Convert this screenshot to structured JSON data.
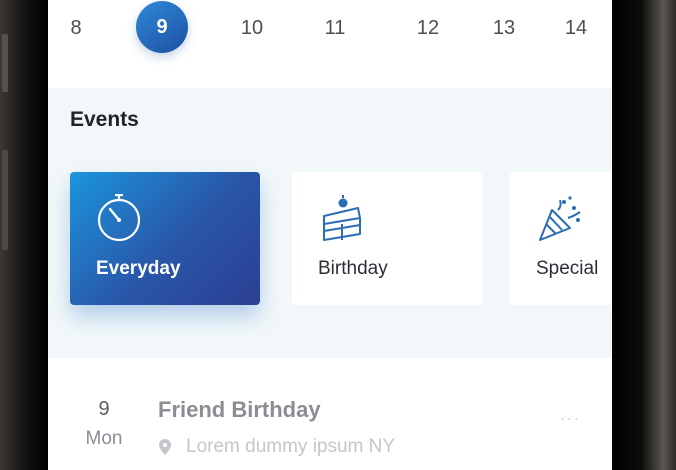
{
  "dates": {
    "items": [
      "8",
      "10",
      "11",
      "12",
      "13",
      "14"
    ],
    "selected": "9"
  },
  "events": {
    "title": "Events",
    "cards": [
      {
        "label": "Everyday",
        "icon": "stopwatch-icon"
      },
      {
        "label": "Birthday",
        "icon": "cake-icon"
      },
      {
        "label": "Special",
        "icon": "party-popper-icon"
      }
    ]
  },
  "list": {
    "item": {
      "day": "9",
      "weekday": "Mon",
      "title": "Friend Birthday",
      "location": "Lorem dummy ipsum NY",
      "more": "..."
    }
  },
  "colors": {
    "accent_start": "#1b95dd",
    "accent_end": "#2b3f93",
    "icon_blue": "#2a6db5"
  }
}
